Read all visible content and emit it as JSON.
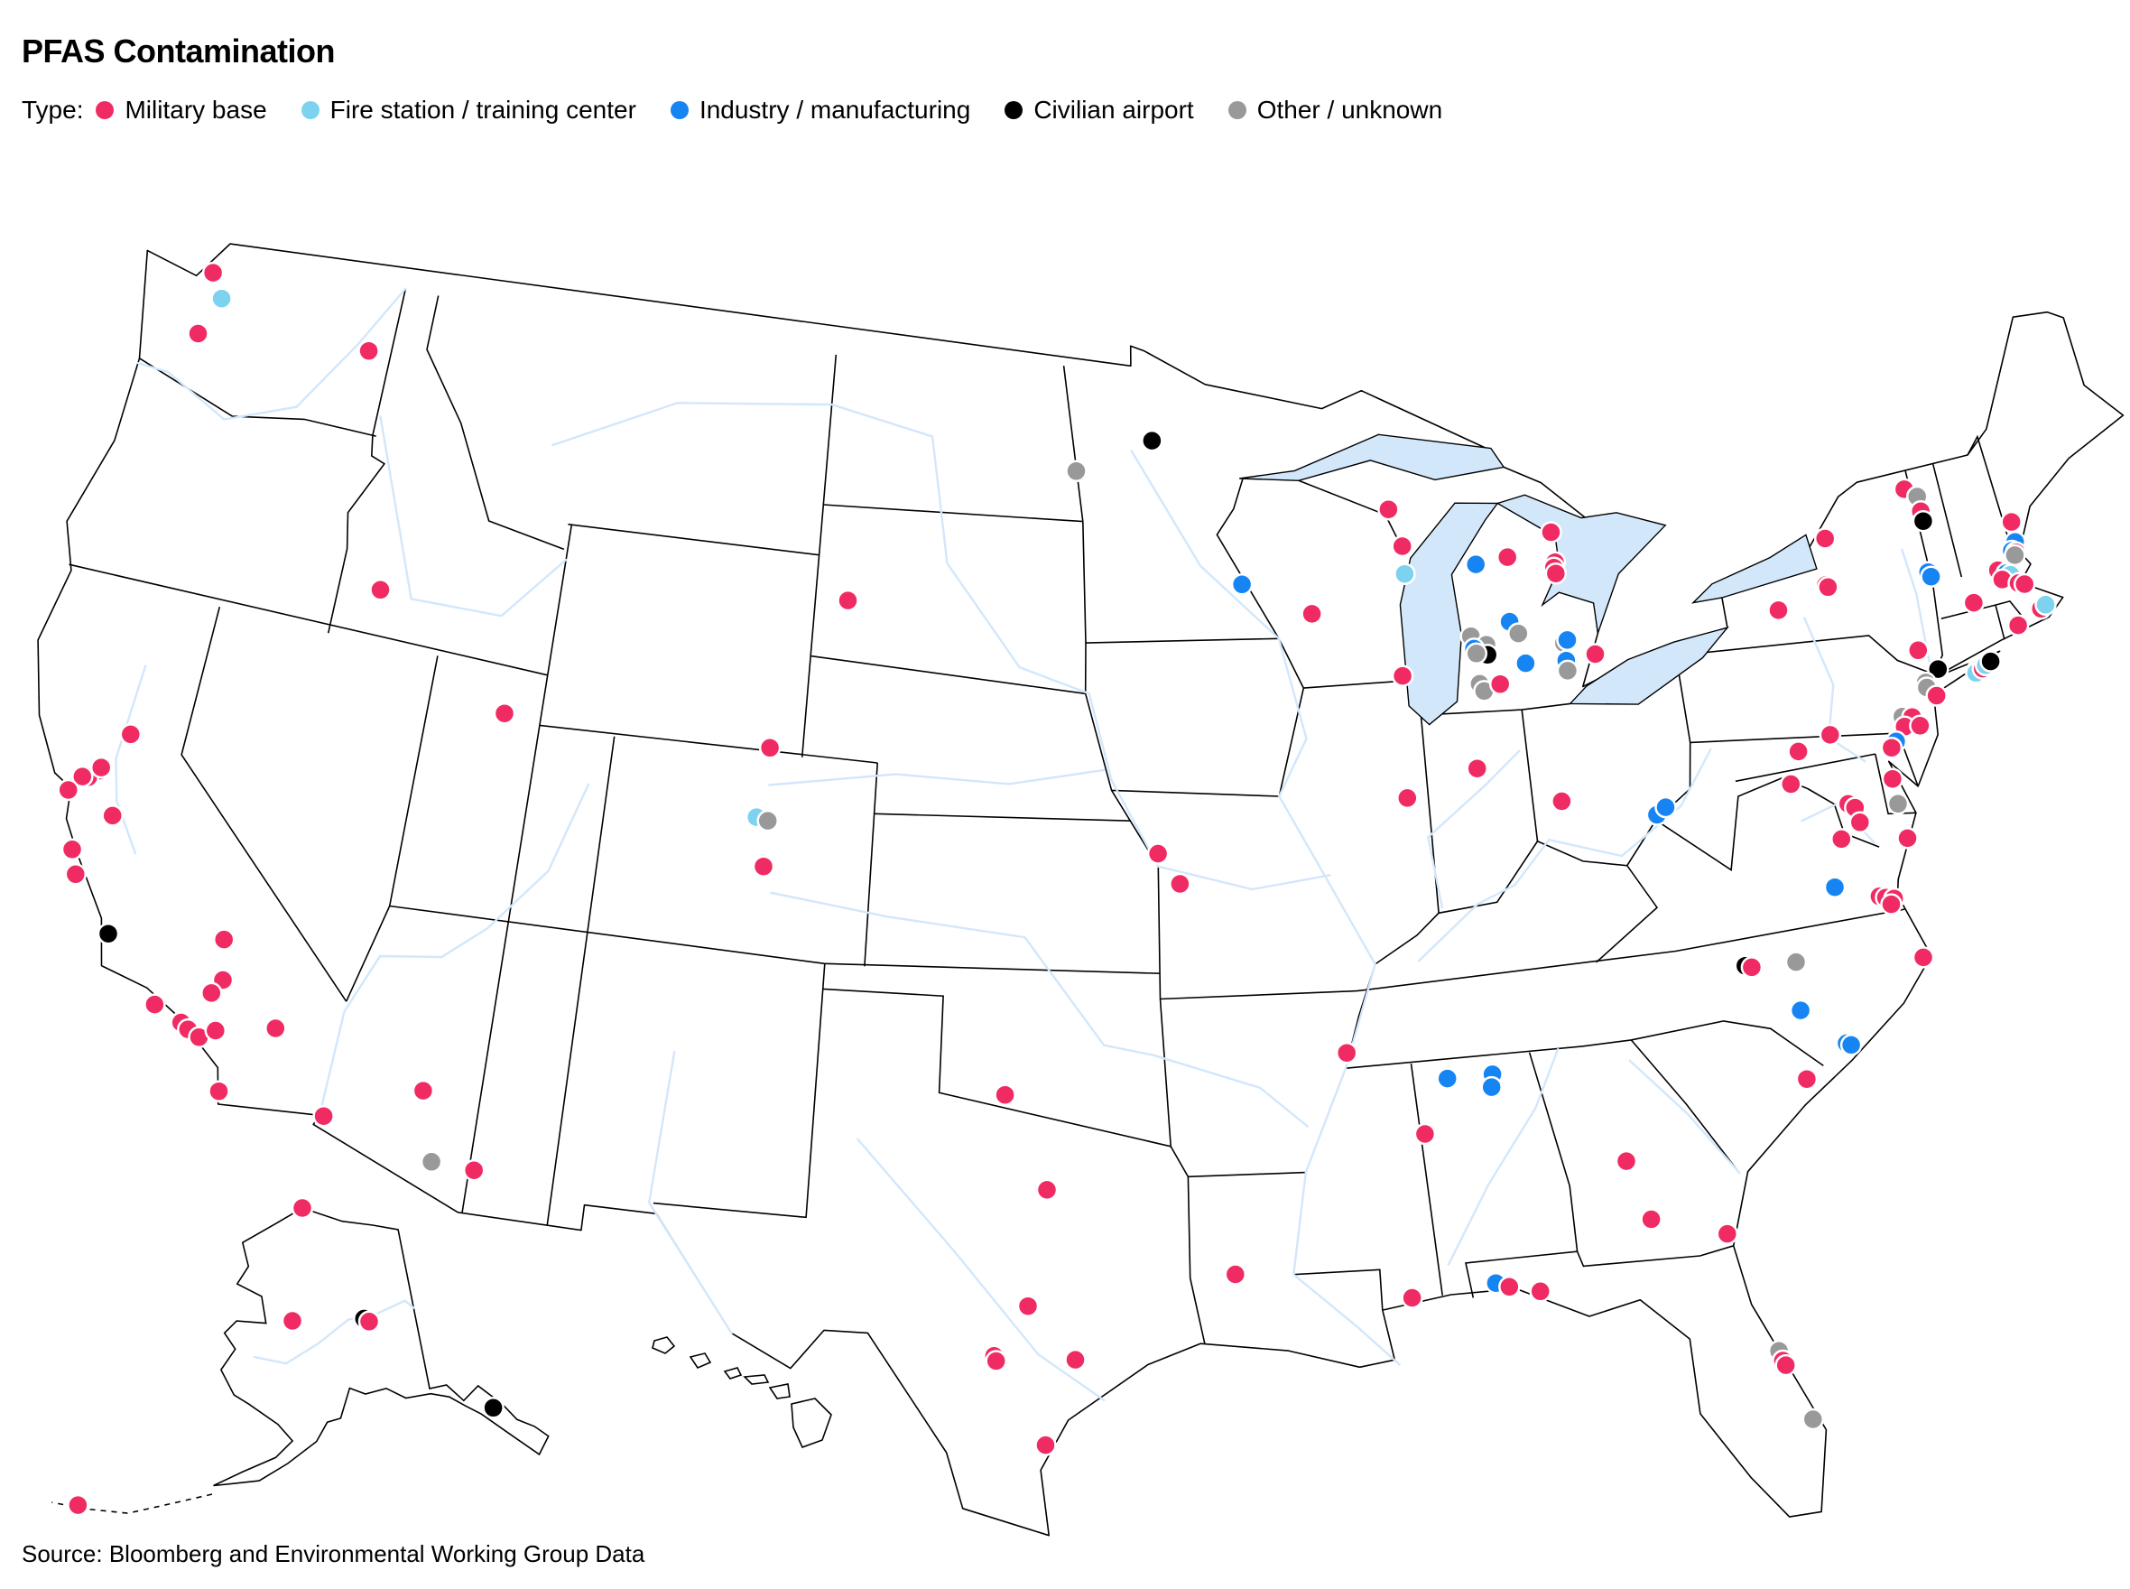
{
  "title": "PFAS Contamination",
  "legend": {
    "label": "Type:",
    "items": [
      {
        "key": "military",
        "label": "Military base",
        "color": "#f02b63"
      },
      {
        "key": "fire",
        "label": "Fire station / training center",
        "color": "#7dd3ef"
      },
      {
        "key": "industry",
        "label": "Industry / manufacturing",
        "color": "#1685f3"
      },
      {
        "key": "airport",
        "label": "Civilian airport",
        "color": "#000000"
      },
      {
        "key": "other",
        "label": "Other / unknown",
        "color": "#999999"
      }
    ]
  },
  "source": "Source: Bloomberg and Environmental Working Group Data",
  "chart_data": {
    "type": "scatter",
    "subtype": "point-map",
    "title": "PFAS Contamination",
    "legend_position": "top-left",
    "region": "United States (lower 48 with Alaska and Hawaii insets)",
    "categories": [
      "Military base",
      "Fire station / training center",
      "Industry / manufacturing",
      "Civilian airport",
      "Other / unknown"
    ],
    "sites": [
      {
        "type": "military",
        "lon": -122.65,
        "lat": 48.35
      },
      {
        "type": "fire",
        "lon": -122.2,
        "lat": 47.9
      },
      {
        "type": "military",
        "lon": -122.58,
        "lat": 47.1
      },
      {
        "type": "military",
        "lon": -117.65,
        "lat": 47.62
      },
      {
        "type": "military",
        "lon": -115.87,
        "lat": 43.05
      },
      {
        "type": "military",
        "lon": -111.97,
        "lat": 41.12
      },
      {
        "type": "military",
        "lon": -121.4,
        "lat": 39.13
      },
      {
        "type": "military",
        "lon": -121.95,
        "lat": 38.27
      },
      {
        "type": "military",
        "lon": -122.15,
        "lat": 38.1
      },
      {
        "type": "military",
        "lon": -121.9,
        "lat": 38.35
      },
      {
        "type": "military",
        "lon": -122.3,
        "lat": 38.08
      },
      {
        "type": "military",
        "lon": -122.55,
        "lat": 37.75
      },
      {
        "type": "military",
        "lon": -121.3,
        "lat": 37.5
      },
      {
        "type": "military",
        "lon": -122.05,
        "lat": 36.65
      },
      {
        "type": "military",
        "lon": -121.8,
        "lat": 36.2
      },
      {
        "type": "airport",
        "lon": -120.64,
        "lat": 35.24
      },
      {
        "type": "military",
        "lon": -117.85,
        "lat": 35.68
      },
      {
        "type": "military",
        "lon": -117.65,
        "lat": 34.9
      },
      {
        "type": "military",
        "lon": -117.85,
        "lat": 34.6
      },
      {
        "type": "military",
        "lon": -119.12,
        "lat": 34.12
      },
      {
        "type": "military",
        "lon": -118.4,
        "lat": 33.9
      },
      {
        "type": "military",
        "lon": -118.2,
        "lat": 33.8
      },
      {
        "type": "military",
        "lon": -117.9,
        "lat": 33.7
      },
      {
        "type": "military",
        "lon": -117.55,
        "lat": 33.9
      },
      {
        "type": "military",
        "lon": -116.15,
        "lat": 34.2
      },
      {
        "type": "military",
        "lon": -117.15,
        "lat": 32.75
      },
      {
        "type": "military",
        "lon": -114.6,
        "lat": 32.7
      },
      {
        "type": "military",
        "lon": -112.38,
        "lat": 33.55
      },
      {
        "type": "other",
        "lon": -111.9,
        "lat": 32.2
      },
      {
        "type": "military",
        "lon": -110.88,
        "lat": 32.17
      },
      {
        "type": "military",
        "lon": -104.87,
        "lat": 41.13
      },
      {
        "type": "fire",
        "lon": -105.05,
        "lat": 39.75
      },
      {
        "type": "other",
        "lon": -104.75,
        "lat": 39.7
      },
      {
        "type": "military",
        "lon": -104.75,
        "lat": 38.8
      },
      {
        "type": "military",
        "lon": -103.1,
        "lat": 44.15
      },
      {
        "type": "other",
        "lon": -96.8,
        "lat": 46.9
      },
      {
        "type": "airport",
        "lon": -94.6,
        "lat": 47.5
      },
      {
        "type": "industry",
        "lon": -92.15,
        "lat": 44.6
      },
      {
        "type": "military",
        "lon": -90.25,
        "lat": 43.95
      },
      {
        "type": "military",
        "lon": -87.9,
        "lat": 45.9
      },
      {
        "type": "military",
        "lon": -87.6,
        "lat": 45.15
      },
      {
        "type": "fire",
        "lon": -87.6,
        "lat": 44.6
      },
      {
        "type": "military",
        "lon": -87.9,
        "lat": 42.6
      },
      {
        "type": "military",
        "lon": -94.6,
        "lat": 39.35
      },
      {
        "type": "military",
        "lon": -94.05,
        "lat": 38.75
      },
      {
        "type": "military",
        "lon": -88.05,
        "lat": 40.2
      },
      {
        "type": "military",
        "lon": -86.15,
        "lat": 40.65
      },
      {
        "type": "military",
        "lon": -84.05,
        "lat": 39.82
      },
      {
        "type": "industry",
        "lon": -81.65,
        "lat": 39.3
      },
      {
        "type": "industry",
        "lon": -81.4,
        "lat": 39.42
      },
      {
        "type": "industry",
        "lon": -85.6,
        "lat": 44.65
      },
      {
        "type": "military",
        "lon": -84.7,
        "lat": 44.72
      },
      {
        "type": "military",
        "lon": -83.4,
        "lat": 45.1
      },
      {
        "type": "military",
        "lon": -83.4,
        "lat": 44.5
      },
      {
        "type": "military",
        "lon": -83.45,
        "lat": 44.4
      },
      {
        "type": "military",
        "lon": -83.42,
        "lat": 44.28
      },
      {
        "type": "industry",
        "lon": -84.85,
        "lat": 43.45
      },
      {
        "type": "other",
        "lon": -85.95,
        "lat": 43.25
      },
      {
        "type": "other",
        "lon": -84.65,
        "lat": 43.2
      },
      {
        "type": "other",
        "lon": -85.55,
        "lat": 43.05
      },
      {
        "type": "industry",
        "lon": -85.9,
        "lat": 43.0
      },
      {
        "type": "airport",
        "lon": -85.55,
        "lat": 42.85
      },
      {
        "type": "other",
        "lon": -85.85,
        "lat": 42.9
      },
      {
        "type": "industry",
        "lon": -84.55,
        "lat": 42.6
      },
      {
        "type": "other",
        "lon": -83.45,
        "lat": 42.9
      },
      {
        "type": "industry",
        "lon": -83.35,
        "lat": 42.95
      },
      {
        "type": "industry",
        "lon": -83.45,
        "lat": 42.55
      },
      {
        "type": "other",
        "lon": -83.45,
        "lat": 42.35
      },
      {
        "type": "military",
        "lon": -82.65,
        "lat": 42.6
      },
      {
        "type": "other",
        "lon": -85.85,
        "lat": 42.3
      },
      {
        "type": "other",
        "lon": -85.75,
        "lat": 42.15
      },
      {
        "type": "military",
        "lon": -85.3,
        "lat": 42.25
      },
      {
        "type": "military",
        "lon": -75.9,
        "lat": 44.05
      },
      {
        "type": "military",
        "lon": -76.15,
        "lat": 43.15
      },
      {
        "type": "military",
        "lon": -76.1,
        "lat": 43.1
      },
      {
        "type": "military",
        "lon": -77.55,
        "lat": 42.85
      },
      {
        "type": "military",
        "lon": -73.45,
        "lat": 44.65
      },
      {
        "type": "other",
        "lon": -73.15,
        "lat": 44.45
      },
      {
        "type": "military",
        "lon": -73.15,
        "lat": 44.15
      },
      {
        "type": "airport",
        "lon": -73.15,
        "lat": 43.95
      },
      {
        "type": "industry",
        "lon": -73.35,
        "lat": 42.95
      },
      {
        "type": "industry",
        "lon": -73.3,
        "lat": 42.85
      },
      {
        "type": "military",
        "lon": -72.35,
        "lat": 42.15
      },
      {
        "type": "military",
        "lon": -70.8,
        "lat": 43.5
      },
      {
        "type": "industry",
        "lon": -70.85,
        "lat": 43.1
      },
      {
        "type": "industry",
        "lon": -71.0,
        "lat": 42.95
      },
      {
        "type": "military",
        "lon": -70.9,
        "lat": 42.9
      },
      {
        "type": "other",
        "lon": -70.95,
        "lat": 42.85
      },
      {
        "type": "military",
        "lon": -71.5,
        "lat": 42.65
      },
      {
        "type": "industry",
        "lon": -71.3,
        "lat": 42.55
      },
      {
        "type": "fire",
        "lon": -71.2,
        "lat": 42.5
      },
      {
        "type": "military",
        "lon": -71.45,
        "lat": 42.45
      },
      {
        "type": "military",
        "lon": -71.05,
        "lat": 42.3
      },
      {
        "type": "military",
        "lon": -70.9,
        "lat": 42.25
      },
      {
        "type": "military",
        "lon": -70.65,
        "lat": 41.7
      },
      {
        "type": "fire",
        "lon": -70.5,
        "lat": 41.75
      },
      {
        "type": "military",
        "lon": -71.35,
        "lat": 41.5
      },
      {
        "type": "military",
        "lon": -74.1,
        "lat": 41.5
      },
      {
        "type": "airport",
        "lon": -73.7,
        "lat": 41.05
      },
      {
        "type": "military",
        "lon": -72.7,
        "lat": 40.85
      },
      {
        "type": "fire",
        "lon": -72.75,
        "lat": 40.8
      },
      {
        "type": "military",
        "lon": -72.55,
        "lat": 40.85
      },
      {
        "type": "fire",
        "lon": -72.45,
        "lat": 40.9
      },
      {
        "type": "airport",
        "lon": -72.3,
        "lat": 40.95
      },
      {
        "type": "other",
        "lon": -74.1,
        "lat": 40.85
      },
      {
        "type": "other",
        "lon": -74.1,
        "lat": 40.75
      },
      {
        "type": "military",
        "lon": -73.9,
        "lat": 40.55
      },
      {
        "type": "other",
        "lon": -74.9,
        "lat": 40.3
      },
      {
        "type": "military",
        "lon": -74.65,
        "lat": 40.25
      },
      {
        "type": "military",
        "lon": -74.9,
        "lat": 40.1
      },
      {
        "type": "military",
        "lon": -74.5,
        "lat": 40.05
      },
      {
        "type": "industry",
        "lon": -75.2,
        "lat": 39.85
      },
      {
        "type": "military",
        "lon": -75.35,
        "lat": 39.75
      },
      {
        "type": "military",
        "lon": -76.85,
        "lat": 40.25
      },
      {
        "type": "military",
        "lon": -77.75,
        "lat": 40.05
      },
      {
        "type": "military",
        "lon": -78.1,
        "lat": 39.45
      },
      {
        "type": "military",
        "lon": -75.5,
        "lat": 39.15
      },
      {
        "type": "other",
        "lon": -75.5,
        "lat": 38.65
      },
      {
        "type": "military",
        "lon": -76.75,
        "lat": 38.85
      },
      {
        "type": "military",
        "lon": -76.6,
        "lat": 38.75
      },
      {
        "type": "military",
        "lon": -76.55,
        "lat": 38.45
      },
      {
        "type": "military",
        "lon": -77.1,
        "lat": 38.2
      },
      {
        "type": "military",
        "lon": -75.45,
        "lat": 37.95
      },
      {
        "type": "industry",
        "lon": -77.5,
        "lat": 37.3
      },
      {
        "type": "military",
        "lon": -76.45,
        "lat": 36.95
      },
      {
        "type": "military",
        "lon": -76.3,
        "lat": 36.9
      },
      {
        "type": "military",
        "lon": -76.1,
        "lat": 36.85
      },
      {
        "type": "military",
        "lon": -76.2,
        "lat": 36.75
      },
      {
        "type": "airport",
        "lon": -80.05,
        "lat": 36.1
      },
      {
        "type": "military",
        "lon": -79.9,
        "lat": 36.05
      },
      {
        "type": "other",
        "lon": -78.8,
        "lat": 36.0
      },
      {
        "type": "military",
        "lon": -75.7,
        "lat": 35.6
      },
      {
        "type": "industry",
        "lon": -78.9,
        "lat": 35.05
      },
      {
        "type": "industry",
        "lon": -77.95,
        "lat": 34.25
      },
      {
        "type": "industry",
        "lon": -77.85,
        "lat": 34.2
      },
      {
        "type": "military",
        "lon": -79.05,
        "lat": 33.7
      },
      {
        "type": "military",
        "lon": -83.6,
        "lat": 32.65
      },
      {
        "type": "military",
        "lon": -83.2,
        "lat": 31.45
      },
      {
        "type": "military",
        "lon": -81.5,
        "lat": 30.95
      },
      {
        "type": "other",
        "lon": -80.75,
        "lat": 28.5
      },
      {
        "type": "military",
        "lon": -80.7,
        "lat": 28.3
      },
      {
        "type": "military",
        "lon": -80.65,
        "lat": 28.2
      },
      {
        "type": "other",
        "lon": -80.25,
        "lat": 27.05
      },
      {
        "type": "industry",
        "lon": -87.65,
        "lat": 34.65
      },
      {
        "type": "industry",
        "lon": -86.55,
        "lat": 34.65
      },
      {
        "type": "industry",
        "lon": -86.6,
        "lat": 34.4
      },
      {
        "type": "military",
        "lon": -88.3,
        "lat": 33.6
      },
      {
        "type": "military",
        "lon": -88.9,
        "lat": 30.4
      },
      {
        "type": "industry",
        "lon": -86.95,
        "lat": 30.55
      },
      {
        "type": "military",
        "lon": -86.65,
        "lat": 30.45
      },
      {
        "type": "military",
        "lon": -85.95,
        "lat": 30.3
      },
      {
        "type": "military",
        "lon": -90.05,
        "lat": 35.3
      },
      {
        "type": "military",
        "lon": -92.95,
        "lat": 31.05
      },
      {
        "type": "military",
        "lon": -98.4,
        "lat": 34.6
      },
      {
        "type": "military",
        "lon": -97.35,
        "lat": 32.75
      },
      {
        "type": "military",
        "lon": -97.75,
        "lat": 30.45
      },
      {
        "type": "military",
        "lon": -98.5,
        "lat": 29.45
      },
      {
        "type": "military",
        "lon": -98.45,
        "lat": 29.35
      },
      {
        "type": "military",
        "lon": -96.65,
        "lat": 29.4
      },
      {
        "type": "military",
        "lon": -97.3,
        "lat": 27.7
      },
      {
        "type": "military",
        "lon": -156.8,
        "lat": 71.3,
        "inset": "alaska"
      },
      {
        "type": "military",
        "lon": -157.5,
        "lat": 64.75,
        "inset": "alaska"
      },
      {
        "type": "airport",
        "lon": -147.85,
        "lat": 64.8,
        "inset": "alaska"
      },
      {
        "type": "military",
        "lon": -147.2,
        "lat": 64.6,
        "inset": "alaska"
      },
      {
        "type": "airport",
        "lon": -134.55,
        "lat": 58.35,
        "inset": "alaska"
      },
      {
        "type": "military",
        "lon": -176.65,
        "lat": 51.88,
        "inset": "alaska"
      }
    ]
  }
}
